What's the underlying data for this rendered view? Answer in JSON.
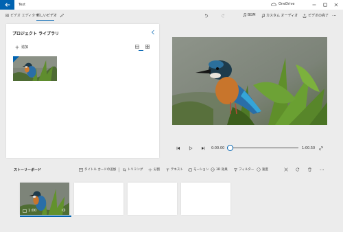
{
  "app": {
    "title": "Text",
    "cloud_label": "OneDrive",
    "back_icon": "back-arrow-icon"
  },
  "toolbar": {
    "tabs": [
      {
        "label": "ビデオ エディター",
        "icon": "grid-icon",
        "active": false
      },
      {
        "label": "新しいビデオ",
        "active": true
      },
      {
        "icon": "pencil-icon"
      }
    ],
    "undo_icon": "undo-icon",
    "redo_icon": "redo-icon",
    "bgm_label": "BGM",
    "custom_audio_label": "カスタム オーディオ",
    "finish_label": "ビデオの完了",
    "more_label": "..."
  },
  "library": {
    "title": "プロジェクト ライブラリ",
    "add_label": "追加",
    "selected_view": "grid"
  },
  "player": {
    "current_time": "0:00.00",
    "total_time": "1:00.50",
    "progress": 0
  },
  "storyboard": {
    "title": "ストーリーボード",
    "tools": [
      {
        "label": "タイトル カードの追加",
        "icon": "title-card-icon"
      },
      {
        "label": "トリミング",
        "icon": "trim-icon"
      },
      {
        "label": "分割",
        "icon": "split-icon"
      },
      {
        "label": "テキスト",
        "icon": "text-icon"
      },
      {
        "label": "モーション",
        "icon": "motion-icon"
      },
      {
        "label": "3D 効果",
        "icon": "3d-effects-icon"
      },
      {
        "label": "フィルター",
        "icon": "filter-icon"
      },
      {
        "label": "速度",
        "icon": "speed-icon"
      }
    ],
    "clips": [
      {
        "duration": "1:00",
        "has_video": true
      },
      {
        "has_video": false
      },
      {
        "has_video": false
      },
      {
        "has_video": false
      }
    ]
  },
  "colors": {
    "accent": "#0063b1",
    "background": "#ececec",
    "panel": "#ffffff"
  }
}
